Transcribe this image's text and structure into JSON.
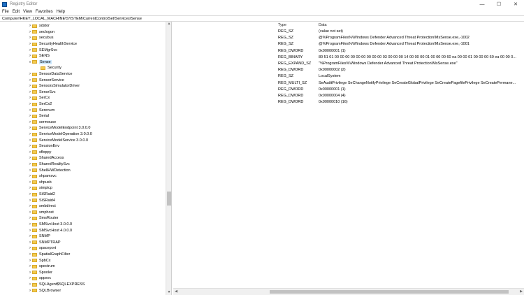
{
  "window": {
    "title": "Registry Editor",
    "controls": [
      "—",
      "☐",
      "✕"
    ]
  },
  "menu": [
    "File",
    "Edit",
    "View",
    "Favorites",
    "Help"
  ],
  "address": "Computer\\HKEY_LOCAL_MACHINE\\SYSTEM\\CurrentControlSet\\Services\\Sense",
  "tree": [
    {
      "label": "sdstor",
      "indent": 1,
      "chevron": ">"
    },
    {
      "label": "seclogon",
      "indent": 1,
      "chevron": ">"
    },
    {
      "label": "secubus",
      "indent": 1,
      "chevron": ">"
    },
    {
      "label": "SecurityHealthService",
      "indent": 1,
      "chevron": ">"
    },
    {
      "label": "SEMgrSvc",
      "indent": 1,
      "chevron": ">"
    },
    {
      "label": "SENS",
      "indent": 1,
      "chevron": ">"
    },
    {
      "label": "Sense",
      "indent": 1,
      "chevron": "v",
      "selected": true
    },
    {
      "label": "Security",
      "indent": 2,
      "chevron": ""
    },
    {
      "label": "SensorDataService",
      "indent": 1,
      "chevron": ">"
    },
    {
      "label": "SensorService",
      "indent": 1,
      "chevron": ">"
    },
    {
      "label": "SensorsSimulatorDriver",
      "indent": 1,
      "chevron": ">"
    },
    {
      "label": "SensrSvc",
      "indent": 1,
      "chevron": ">"
    },
    {
      "label": "SerCx",
      "indent": 1,
      "chevron": ">"
    },
    {
      "label": "SerCx2",
      "indent": 1,
      "chevron": ">"
    },
    {
      "label": "Serenum",
      "indent": 1,
      "chevron": ">"
    },
    {
      "label": "Serial",
      "indent": 1,
      "chevron": ">"
    },
    {
      "label": "sermouse",
      "indent": 1,
      "chevron": ">"
    },
    {
      "label": "ServiceModelEndpoint 3.0.0.0",
      "indent": 1,
      "chevron": ">"
    },
    {
      "label": "ServiceModelOperation 3.0.0.0",
      "indent": 1,
      "chevron": ">"
    },
    {
      "label": "ServiceModelService 3.0.0.0",
      "indent": 1,
      "chevron": ">"
    },
    {
      "label": "SessionEnv",
      "indent": 1,
      "chevron": ">"
    },
    {
      "label": "sfloppy",
      "indent": 1,
      "chevron": ">"
    },
    {
      "label": "SharedAccess",
      "indent": 1,
      "chevron": ">"
    },
    {
      "label": "SharedRealitySvc",
      "indent": 1,
      "chevron": ">"
    },
    {
      "label": "ShellHWDetection",
      "indent": 1,
      "chevron": ">"
    },
    {
      "label": "shpamsvc",
      "indent": 1,
      "chevron": ">"
    },
    {
      "label": "shpusb",
      "indent": 1,
      "chevron": ">"
    },
    {
      "label": "simptcp",
      "indent": 1,
      "chevron": ">"
    },
    {
      "label": "SiSRaid2",
      "indent": 1,
      "chevron": ">"
    },
    {
      "label": "SiSRaid4",
      "indent": 1,
      "chevron": ">"
    },
    {
      "label": "smbdirect",
      "indent": 1,
      "chevron": ">"
    },
    {
      "label": "smphost",
      "indent": 1,
      "chevron": ">"
    },
    {
      "label": "SmsRouter",
      "indent": 1,
      "chevron": ">"
    },
    {
      "label": "SMSvcHost 3.0.0.0",
      "indent": 1,
      "chevron": ">"
    },
    {
      "label": "SMSvcHost 4.0.0.0",
      "indent": 1,
      "chevron": ">"
    },
    {
      "label": "SNMP",
      "indent": 1,
      "chevron": ">"
    },
    {
      "label": "SNMPTRAP",
      "indent": 1,
      "chevron": ">"
    },
    {
      "label": "spaceport",
      "indent": 1,
      "chevron": ">"
    },
    {
      "label": "SpatialGraphFilter",
      "indent": 1,
      "chevron": ">"
    },
    {
      "label": "SpbCx",
      "indent": 1,
      "chevron": ">"
    },
    {
      "label": "spectrum",
      "indent": 1,
      "chevron": ">"
    },
    {
      "label": "Spooler",
      "indent": 1,
      "chevron": ">"
    },
    {
      "label": "sppsvc",
      "indent": 1,
      "chevron": ">"
    },
    {
      "label": "SQLAgent$SQLEXPRESS",
      "indent": 1,
      "chevron": ">"
    },
    {
      "label": "SQLBrowser",
      "indent": 1,
      "chevron": ">"
    }
  ],
  "columns": {
    "type": "Type",
    "data": "Data"
  },
  "values": [
    {
      "type": "REG_SZ",
      "data": "(value not set)"
    },
    {
      "type": "REG_SZ",
      "data": "@%ProgramFiles%\\Windows Defender Advanced Threat Protection\\MsSense.exe,-1002"
    },
    {
      "type": "REG_SZ",
      "data": "@%ProgramFiles%\\Windows Defender Advanced Threat Protection\\MsSense.exe,-1001"
    },
    {
      "type": "REG_DWORD",
      "data": "0x00000001 (1)"
    },
    {
      "type": "REG_BINARY",
      "data": "80 51 01 00 00 00 00 00 00 00 00 00 03 00 00 00 14 00 00 00 01 00 00 00 60 ea 00 00 01 00 00 00 60 ea 00 00 0..."
    },
    {
      "type": "REG_EXPAND_SZ",
      "data": "\"%ProgramFiles%\\Windows Defender Advanced Threat Protection\\MsSense.exe\""
    },
    {
      "type": "REG_DWORD",
      "data": "0x00000002 (2)"
    },
    {
      "type": "REG_SZ",
      "data": "LocalSystem"
    },
    {
      "type": "REG_MULTI_SZ",
      "data": "SeAuditPrivilege SeChangeNotifyPrivilege SeCreateGlobalPrivilege SeCreatePagefilePrivilege SeCreatePermane..."
    },
    {
      "type": "REG_DWORD",
      "data": "0x00000001 (1)"
    },
    {
      "type": "REG_DWORD",
      "data": "0x00000004 (4)"
    },
    {
      "type": "REG_DWORD",
      "data": "0x00000010 (16)"
    }
  ]
}
